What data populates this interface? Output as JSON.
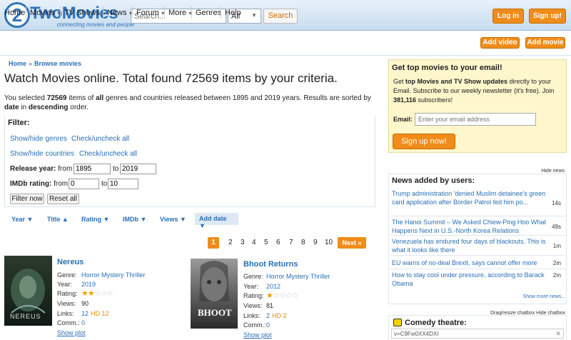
{
  "header": {
    "logo_digit": "2",
    "logo_word": "TwoMovies",
    "logo_tagline": "connecting movies and people",
    "search_placeholder": "Search...",
    "search_select": "All",
    "search_button": "Search",
    "login": "Log in",
    "signup": "Sign up!"
  },
  "nav": {
    "items": [
      "Home",
      "Movies",
      "TV Shows",
      "News",
      "Forum",
      "More",
      "Genres",
      "Help"
    ],
    "add_video": "Add video",
    "add_movie": "Add movie"
  },
  "breadcrumb": [
    "Home",
    "Browse movies"
  ],
  "page_title": "Watch Movies online. Total found 72569 items by your criteria.",
  "summary": {
    "p1": "You selected ",
    "count": "72569",
    "p2": " items of ",
    "all": "all",
    "p3": " genres and countries released between 1895 and 2019 years. Results are sorted by ",
    "sort_field": "date",
    "p4": " in ",
    "sort_dir": "descending",
    "p5": " order."
  },
  "filter": {
    "label": "Filter:",
    "show_genres": "Show/hide genres",
    "check_genres": "Check/uncheck all",
    "show_countries": "Show/hide countries",
    "check_countries": "Check/uncheck all",
    "release_label": "Release year:",
    "from": "from",
    "to": "to",
    "year_from": "1895",
    "year_to": "2019",
    "imdb_label": "IMDb rating:",
    "imdb_from": "0",
    "imdb_to": "10",
    "filter_now": "Filter now",
    "reset_all": "Reset all"
  },
  "sort": [
    "Year ▼",
    "Title ▲",
    "Rating ▼",
    "IMDb ▼",
    "Views ▼",
    "Add date ▼"
  ],
  "pagination": {
    "current": "1",
    "pages": [
      "2",
      "3",
      "4",
      "5",
      "6",
      "7",
      "8",
      "9",
      "10"
    ],
    "next": "Next »"
  },
  "labels": {
    "genre": "Genre:",
    "year": "Year:",
    "rating": "Rating:",
    "views": "Views:",
    "links": "Links:",
    "comm": "Comm.:",
    "show_plot": "Show plot"
  },
  "movies": [
    {
      "title": "Nereus",
      "poster_text": "NEREUS",
      "genres": [
        "Horror",
        "Mystery",
        "Thriller"
      ],
      "year": "2019",
      "rating_stars": 2,
      "views": "90",
      "links": "12",
      "hd": "HD 12",
      "comm": "0"
    },
    {
      "title": "Bhoot Returns",
      "poster_text": "BHOOT",
      "genres": [
        "Horror",
        "Mystery",
        "Thriller"
      ],
      "year": "2012",
      "rating_stars": 1,
      "views": "81",
      "links": "2",
      "hd": "HD 2",
      "comm": "0"
    }
  ],
  "signup_box": {
    "title": "Get top movies to your email!",
    "t1": "Get ",
    "t_bold": "top Movies and TV Show updates",
    "t2": " directly to your Email. Subscribe to our weekly newsletter (it's free). Join ",
    "subscribers": "381,116",
    "t3": " subscribers!",
    "email_label": "Email:",
    "email_placeholder": "Enter your email address",
    "button": "Sign up now!"
  },
  "news": {
    "hide": "Hide news",
    "title": "News added by users:",
    "items": [
      {
        "text": "Trump administration 'denied Muslim detainee's green card application after Border Patrol fed him po...",
        "age": "14s"
      },
      {
        "text": "The Hanoi Summit – We Asked Chiew-Ping Hoo What Happens Next in U.S.-North Korea Relations",
        "age": "49s"
      },
      {
        "text": "Venezuela has endured four days of blackouts. This is what it looks like there",
        "age": "1m"
      },
      {
        "text": "EU warns of no-deal Brexit, says cannot offer more",
        "age": "2m"
      },
      {
        "text": "How to stay cool under pressure, according to Barack Obama",
        "age": "2m"
      }
    ],
    "show_more": "Show more news..."
  },
  "chatbox": {
    "controls": "Drag/resize chatbox  Hide chatbox",
    "title": "Comedy theatre:",
    "field": "v=C9Fw0XX4DXI",
    "close": "✕"
  },
  "colors": {
    "accent": "#f08c1a",
    "link": "#2a6fb4",
    "header_top": "#e8f1fa",
    "signup_bg": "#fff7cc"
  }
}
